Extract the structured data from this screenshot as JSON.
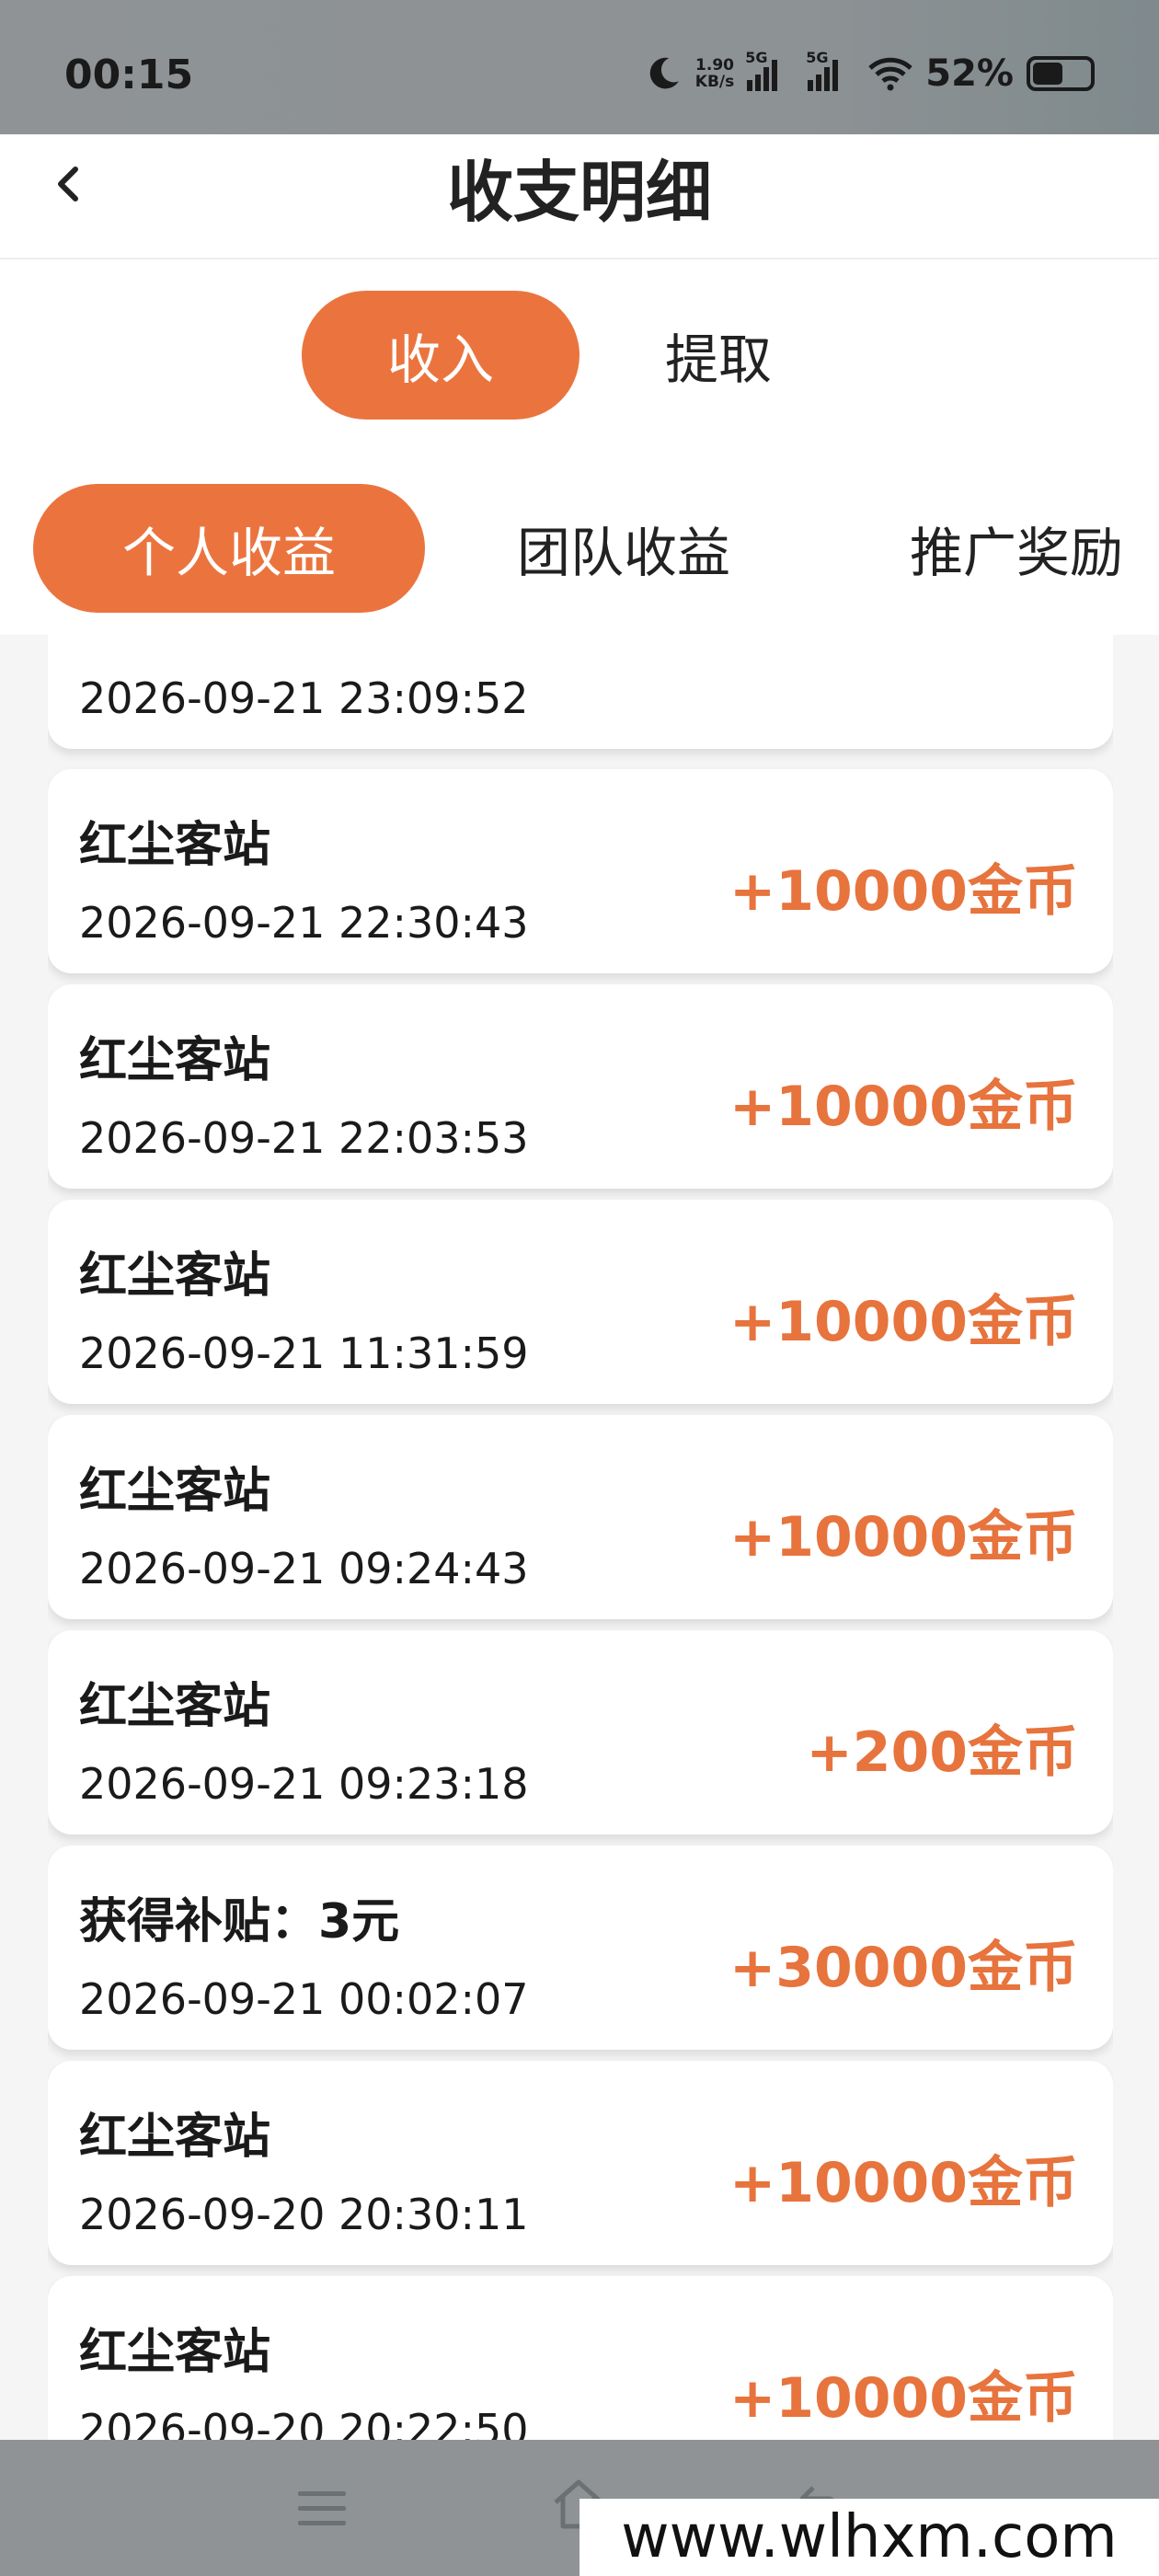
{
  "status_bar": {
    "time": "00:15",
    "speed_top": "1.90",
    "speed_bottom": "KB/s",
    "sig1_label": "5G",
    "sig2_label": "5G",
    "battery": "52%"
  },
  "header": {
    "title": "收支明细"
  },
  "main_tabs": [
    {
      "label": "收入",
      "active": true
    },
    {
      "label": "提取",
      "active": false
    }
  ],
  "sub_tabs": [
    {
      "label": "个人收益",
      "active": true
    },
    {
      "label": "团队收益",
      "active": false
    },
    {
      "label": "推广奖励",
      "active": false
    }
  ],
  "records": [
    {
      "title": "",
      "time": "2026-09-21 23:09:52",
      "amount": ""
    },
    {
      "title": "红尘客站",
      "time": "2026-09-21 22:30:43",
      "amount": "+10000金币"
    },
    {
      "title": "红尘客站",
      "time": "2026-09-21 22:03:53",
      "amount": "+10000金币"
    },
    {
      "title": "红尘客站",
      "time": "2026-09-21 11:31:59",
      "amount": "+10000金币"
    },
    {
      "title": "红尘客站",
      "time": "2026-09-21 09:24:43",
      "amount": "+10000金币"
    },
    {
      "title": "红尘客站",
      "time": "2026-09-21 09:23:18",
      "amount": "+200金币"
    },
    {
      "title": "获得补贴：3元",
      "time": "2026-09-21 00:02:07",
      "amount": "+30000金币"
    },
    {
      "title": "红尘客站",
      "time": "2026-09-20 20:30:11",
      "amount": "+10000金币"
    },
    {
      "title": "红尘客站",
      "time": "2026-09-20 20:22:50",
      "amount": "+10000金币"
    }
  ],
  "watermark": "www.wlhxm.com",
  "colors": {
    "accent": "#eb743e",
    "amount": "#e7733d"
  }
}
